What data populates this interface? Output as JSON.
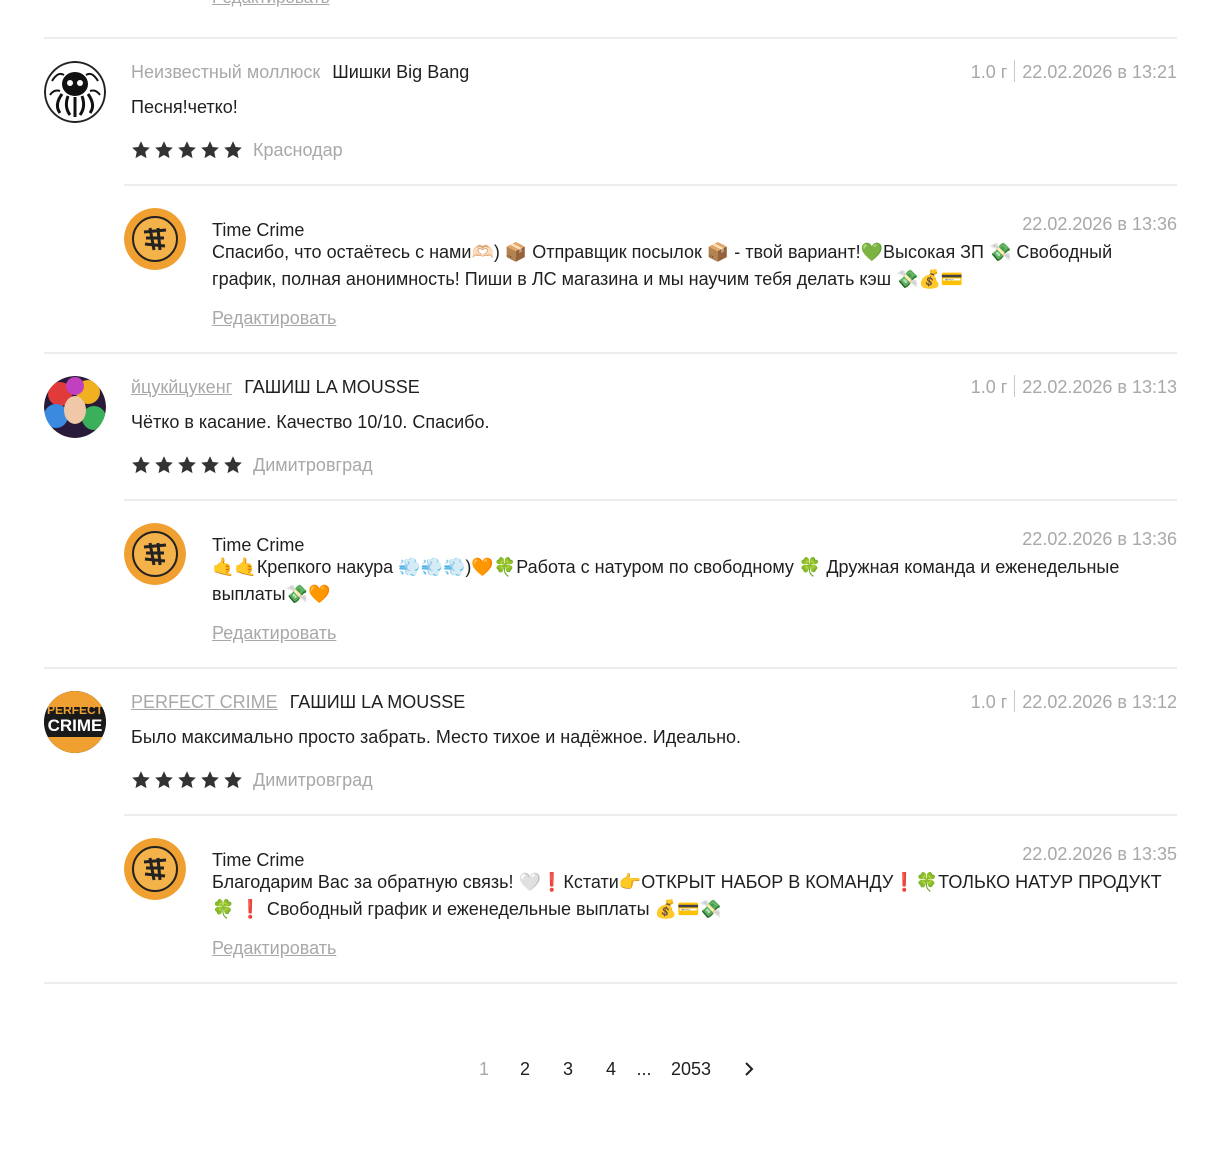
{
  "edit_label": "Редактировать",
  "reviews": [
    {
      "author": "Неизвестный моллюск",
      "product": "Шишки Big Bang",
      "weight": "1.0 г",
      "date": "22.02.2026 в 13:21",
      "text": "Песня!четко!",
      "rating": 5,
      "city": "Краснодар",
      "reply": {
        "author": "Time Crime",
        "date": "22.02.2026 в 13:36",
        "text": "Спасибо, что остаётесь с нами🫶🏻) 📦 Отправщик посылок 📦 - твой вариант!💚Высокая ЗП 💸 Свободный график, полная анонимность! Пиши в ЛС магазина и мы научим тебя делать кэш 💸💰💳"
      }
    },
    {
      "author": "йцукйцукенг",
      "product": "ГАШИШ LA MOUSSE",
      "weight": "1.0 г",
      "date": "22.02.2026 в 13:13",
      "text": "Чётко в касание. Качество 10/10. Спасибо.",
      "rating": 5,
      "city": "Димитровград",
      "reply": {
        "author": "Time Crime",
        "date": "22.02.2026 в 13:36",
        "text": "🤙🤙Крепкого накура 💨💨💨)🧡🍀Работа с натуром по свободному 🍀 Дружная команда и еженедельные выплаты💸🧡"
      }
    },
    {
      "author": "PERFECT CRIME",
      "product": "ГАШИШ LA MOUSSE",
      "weight": "1.0 г",
      "date": "22.02.2026 в 13:12",
      "text": "Было максимально просто забрать. Место тихое и надёжное. Идеально.",
      "rating": 5,
      "city": "Димитровград",
      "avatar_text": "PERFECT CRIME",
      "reply": {
        "author": "Time Crime",
        "date": "22.02.2026 в 13:35",
        "text": "Благодарим Вас за обратную связь! 🤍❗Кстати👉ОТКРЫТ НАБОР В КОМАНДУ❗🍀ТОЛЬКО НАТУР ПРОДУКТ 🍀 ❗ Свободный график и еженедельные выплаты 💰💳💸"
      }
    }
  ],
  "pagination": {
    "pages": [
      "1",
      "2",
      "3",
      "4"
    ],
    "ellipsis": "...",
    "last": "2053",
    "current": "1",
    "next_icon": "chevron-right-icon"
  },
  "colors": {
    "muted": "#a8a8a8",
    "text": "#1f1f1f",
    "star": "#333333",
    "shop_logo": "#f0a030"
  }
}
